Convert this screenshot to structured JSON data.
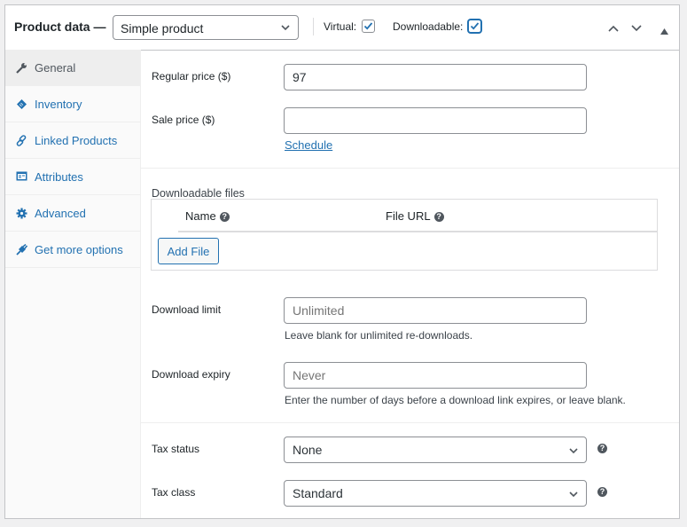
{
  "header": {
    "title": "Product data —",
    "product_type": "Simple product",
    "virtual_label": "Virtual:",
    "virtual_checked": true,
    "downloadable_label": "Downloadable:",
    "downloadable_checked": true
  },
  "sidebar": {
    "items": [
      {
        "label": "General",
        "icon": "wrench-icon",
        "active": true
      },
      {
        "label": "Inventory",
        "icon": "tag-icon",
        "active": false
      },
      {
        "label": "Linked Products",
        "icon": "link-icon",
        "active": false
      },
      {
        "label": "Attributes",
        "icon": "table-icon",
        "active": false
      },
      {
        "label": "Advanced",
        "icon": "gear-icon",
        "active": false
      },
      {
        "label": "Get more options",
        "icon": "plugin-icon",
        "active": false
      }
    ]
  },
  "general": {
    "regular_price_label": "Regular price ($)",
    "regular_price_value": "97",
    "sale_price_label": "Sale price ($)",
    "sale_price_value": "",
    "schedule_link": "Schedule",
    "downloadable_files_title": "Downloadable files",
    "files_table": {
      "columns": [
        "Name",
        "File URL"
      ],
      "rows": []
    },
    "add_file_label": "Add File",
    "download_limit_label": "Download limit",
    "download_limit_placeholder": "Unlimited",
    "download_limit_desc": "Leave blank for unlimited re-downloads.",
    "download_expiry_label": "Download expiry",
    "download_expiry_placeholder": "Never",
    "download_expiry_desc": "Enter the number of days before a download link expires, or leave blank.",
    "tax_status_label": "Tax status",
    "tax_status_value": "None",
    "tax_class_label": "Tax class",
    "tax_class_value": "Standard"
  },
  "colors": {
    "accent": "#2271b1",
    "border": "#8c8f94",
    "text": "#1d2327"
  }
}
